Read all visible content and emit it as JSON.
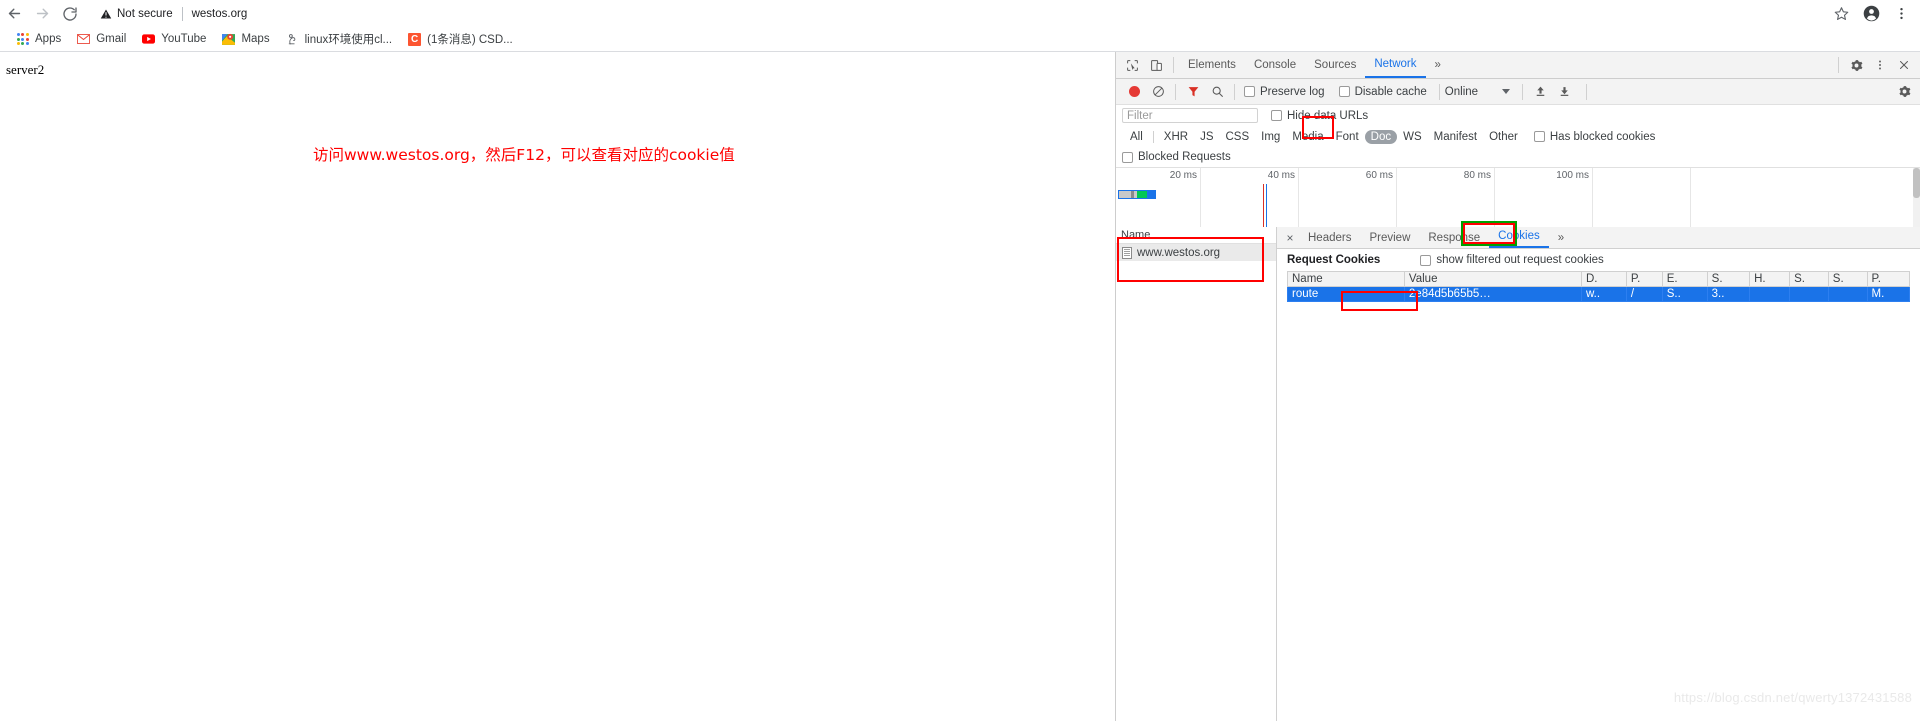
{
  "browser": {
    "nav": {
      "back_label": "Back",
      "forward_label": "Forward",
      "reload_label": "Reload"
    },
    "omnibox": {
      "security_label": "Not secure",
      "url": "westos.org"
    },
    "toolbar_icons": {
      "bookmark": "star-icon",
      "profile": "profile-avatar-icon",
      "menu": "three-dot-menu-icon"
    },
    "bookmarks": [
      {
        "label": "Apps",
        "icon": "apps-grid-icon"
      },
      {
        "label": "Gmail",
        "icon": "gmail-icon"
      },
      {
        "label": "YouTube",
        "icon": "youtube-icon"
      },
      {
        "label": "Maps",
        "icon": "maps-pin-icon"
      },
      {
        "label": "linux环境使用cl...",
        "icon": "site-icon"
      },
      {
        "label": "(1条消息) CSD...",
        "icon": "csdn-icon"
      }
    ]
  },
  "page": {
    "body_text": "server2",
    "annotation": "访问www.westos.org，然后F12，可以查看对应的cookie值"
  },
  "devtools": {
    "panel_tabs": [
      "Elements",
      "Console",
      "Sources",
      "Network"
    ],
    "active_panel_tab": "Network",
    "more_tabs_label": "»",
    "tabbar_icons": {
      "inspect": "inspect-cursor-icon",
      "device": "device-toggle-icon",
      "settings": "gear-icon",
      "more": "three-dot-menu-icon",
      "close": "close-icon"
    },
    "toolbar": {
      "record_label": "record-button",
      "clear_label": "clear-icon",
      "filter_icon": "filter-funnel-icon",
      "search_icon": "search-icon",
      "preserve_log": "Preserve log",
      "disable_cache": "Disable cache",
      "throttling": "Online",
      "import_icon": "import-har-icon",
      "export_icon": "export-har-icon",
      "network_settings_icon": "gear-icon"
    },
    "filter": {
      "placeholder": "Filter",
      "value": "",
      "hide_data_urls": "Hide data URLs",
      "blocked_requests": "Blocked Requests",
      "has_blocked_cookies": "Has blocked cookies",
      "types": [
        "All",
        "XHR",
        "JS",
        "CSS",
        "Img",
        "Media",
        "Font",
        "Doc",
        "WS",
        "Manifest",
        "Other"
      ],
      "active_type": "Doc"
    },
    "overview": {
      "ticks": [
        "20 ms",
        "40 ms",
        "60 ms",
        "80 ms",
        "100 ms"
      ]
    },
    "requests": {
      "column_header": "Name",
      "rows": [
        {
          "name": "www.westos.org",
          "icon": "document-icon",
          "selected": true
        }
      ]
    },
    "detail": {
      "tabs": [
        "Headers",
        "Preview",
        "Response",
        "Cookies"
      ],
      "active_tab": "Cookies",
      "more_label": "»",
      "close_label": "×",
      "request_cookies_title": "Request Cookies",
      "show_filtered_label": "show filtered out request cookies",
      "columns": [
        "Name",
        "Value",
        "D.",
        "P.",
        "E.",
        "S.",
        "H.",
        "S.",
        "S.",
        "P."
      ],
      "rows": [
        {
          "name": "route",
          "value": "2e84d5b65b5…",
          "domain": "w..",
          "path": "/",
          "expires": "S..",
          "size": "3..",
          "httponly": "",
          "secure": "",
          "samesite": "",
          "priority": "M."
        }
      ]
    }
  },
  "watermark": "https://blog.csdn.net/qwerty1372431588",
  "colors": {
    "accent": "#1a73e8",
    "annotation_red": "#ff0000",
    "annotation_green": "#00a000",
    "record_red": "#e53935"
  }
}
